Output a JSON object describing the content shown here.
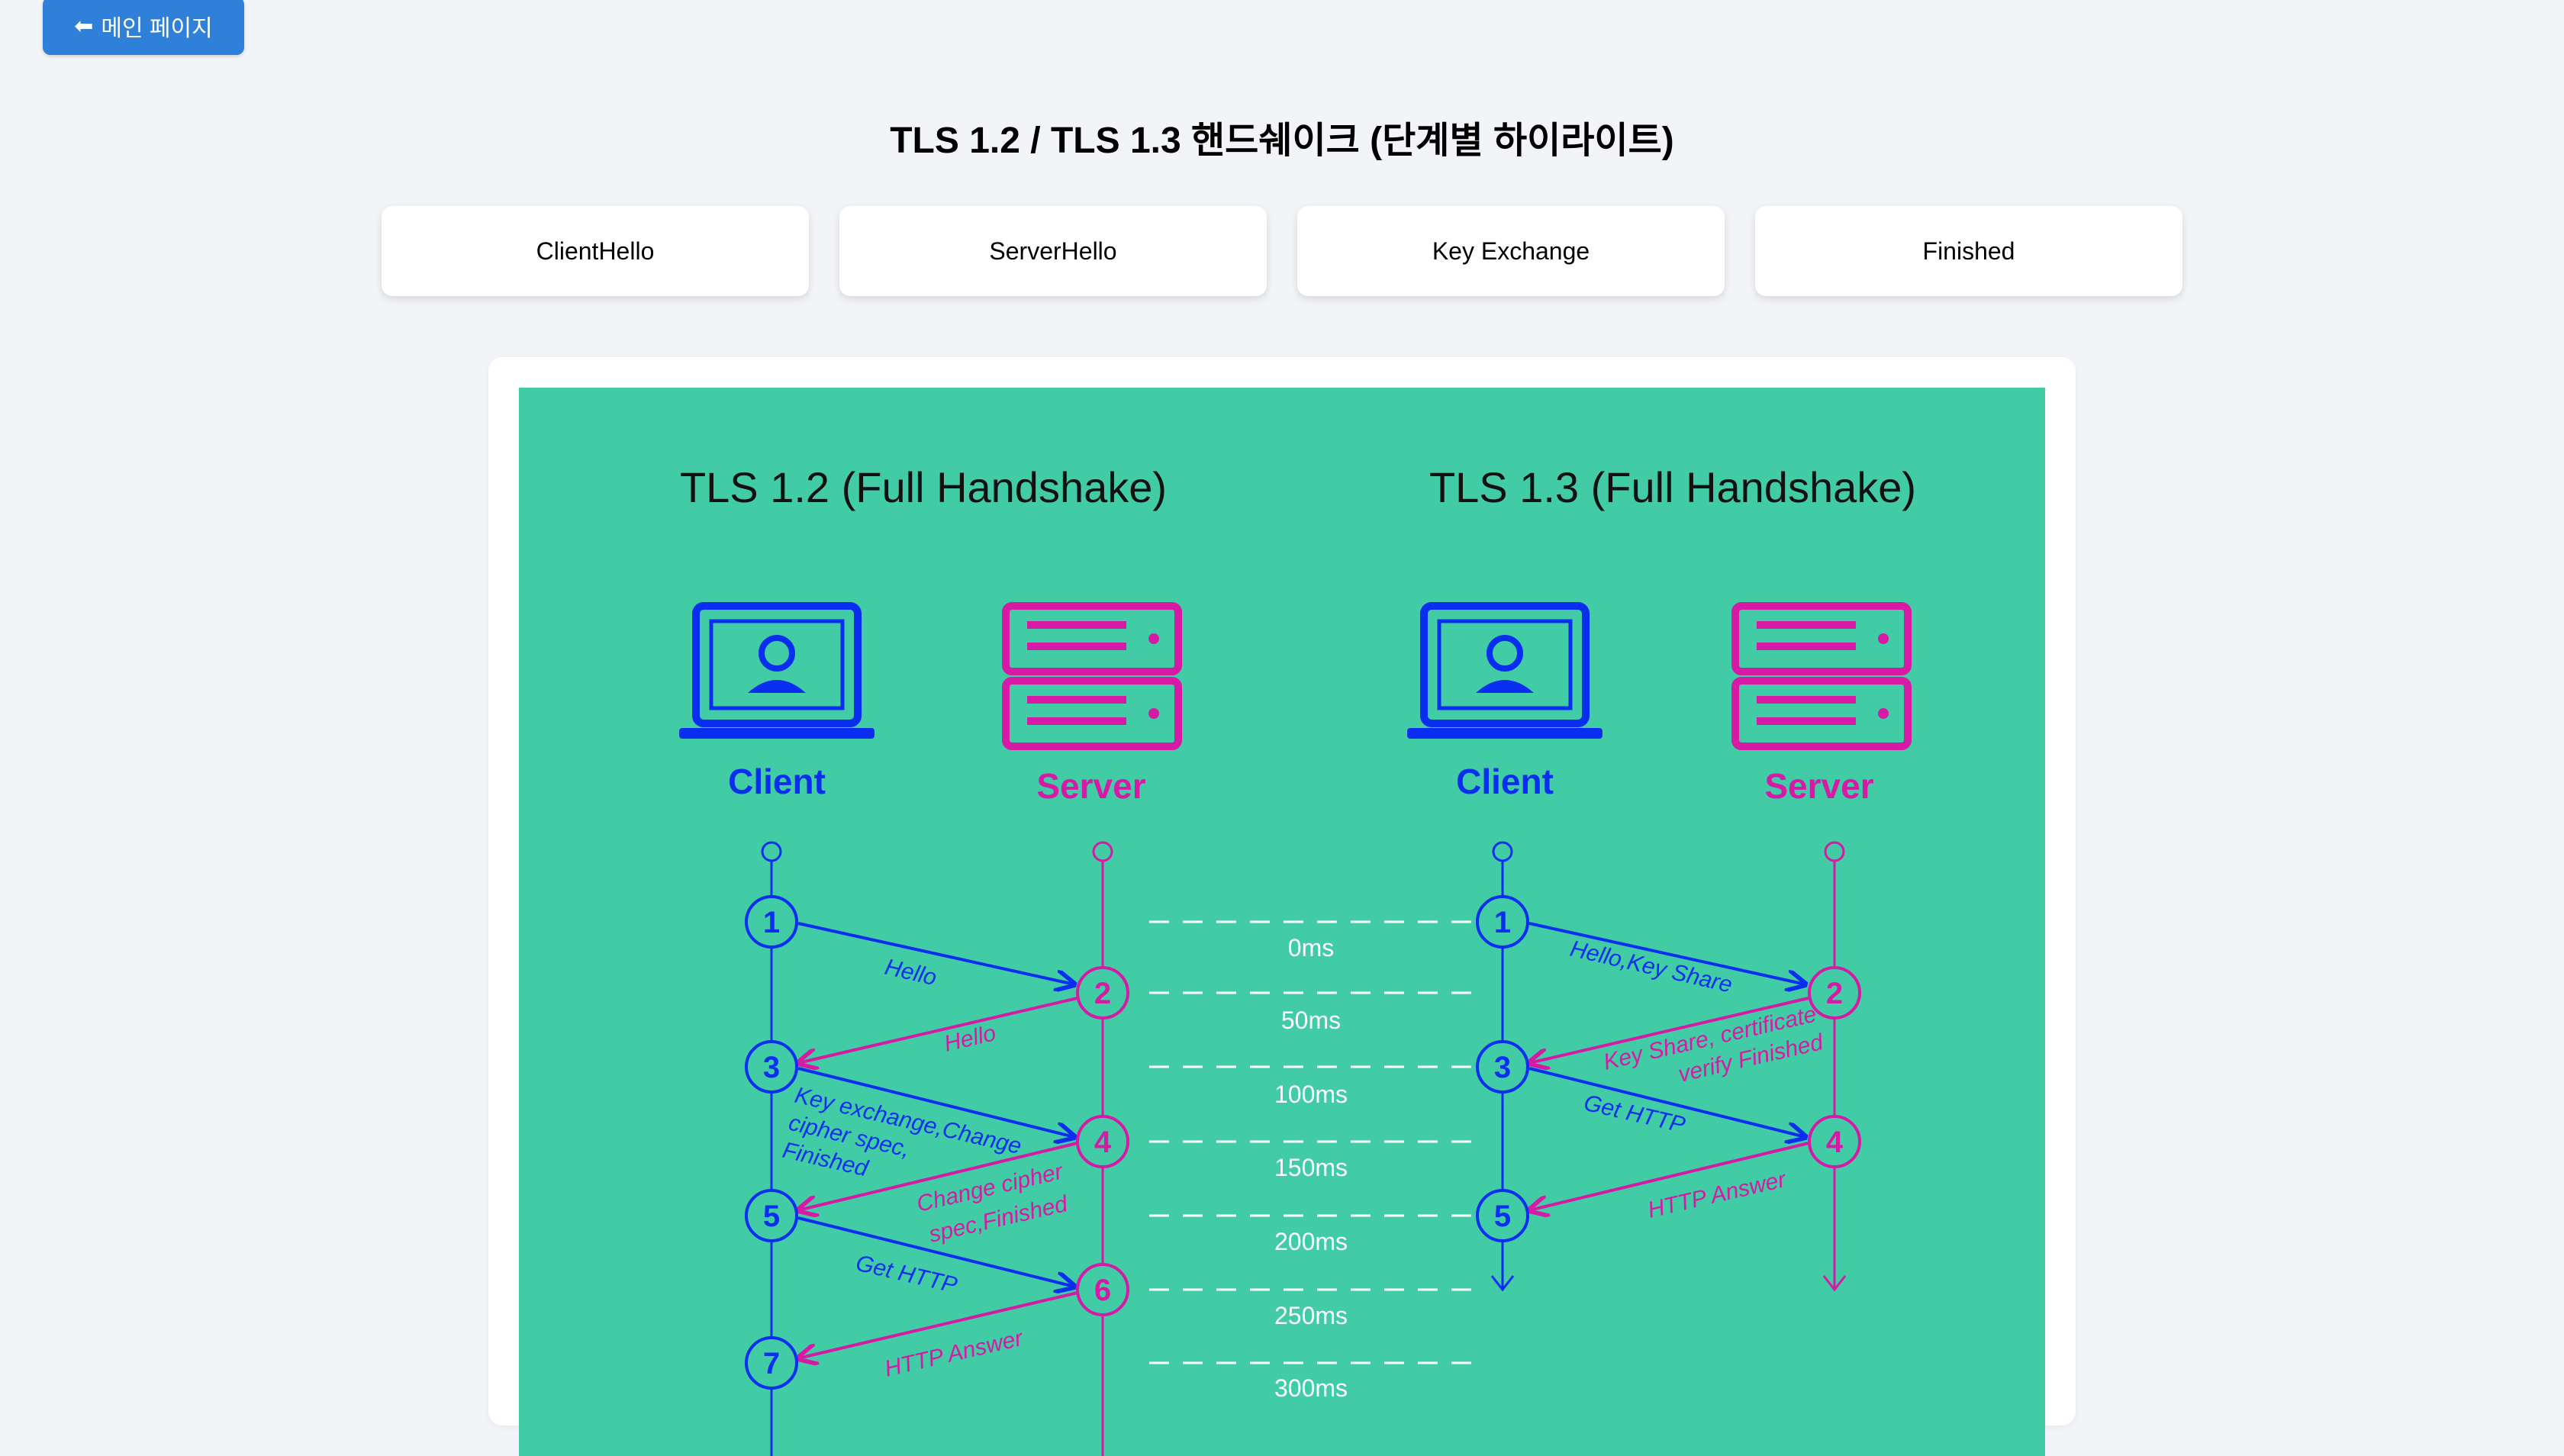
{
  "nav": {
    "back_label": "메인 페이지"
  },
  "page": {
    "title": "TLS 1.2 / TLS 1.3 핸드쉐이크 (단계별 하이라이트)"
  },
  "steps": [
    {
      "label": "ClientHello"
    },
    {
      "label": "ServerHello"
    },
    {
      "label": "Key Exchange"
    },
    {
      "label": "Finished"
    }
  ],
  "diagram": {
    "bg_color": "#41cca6",
    "client_color": "#0a2ef0",
    "server_color": "#d61aa6",
    "tls12": {
      "title": "TLS 1.2 (Full Handshake)",
      "client_label": "Client",
      "server_label": "Server",
      "step_numbers": [
        "1",
        "2",
        "3",
        "4",
        "5",
        "6",
        "7"
      ],
      "messages": {
        "m1": "Hello",
        "m2": "Hello",
        "m3_line1": "Key exchange,Change",
        "m3_line2": "cipher spec,",
        "m3_line3": "Finished",
        "m4_line1": "Change cipher",
        "m4_line2": "spec,Finished",
        "m5": "Get HTTP",
        "m6": "HTTP Answer"
      }
    },
    "tls13": {
      "title": "TLS 1.3 (Full Handshake)",
      "client_label": "Client",
      "server_label": "Server",
      "step_numbers": [
        "1",
        "2",
        "3",
        "4",
        "5"
      ],
      "messages": {
        "m1": "Hello,Key Share",
        "m2_line1": "Key Share, certificate",
        "m2_line2": "verify Finished",
        "m3": "Get HTTP",
        "m4": "HTTP Answer"
      }
    },
    "timeline": [
      "0ms",
      "50ms",
      "100ms",
      "150ms",
      "200ms",
      "250ms",
      "300ms"
    ]
  }
}
